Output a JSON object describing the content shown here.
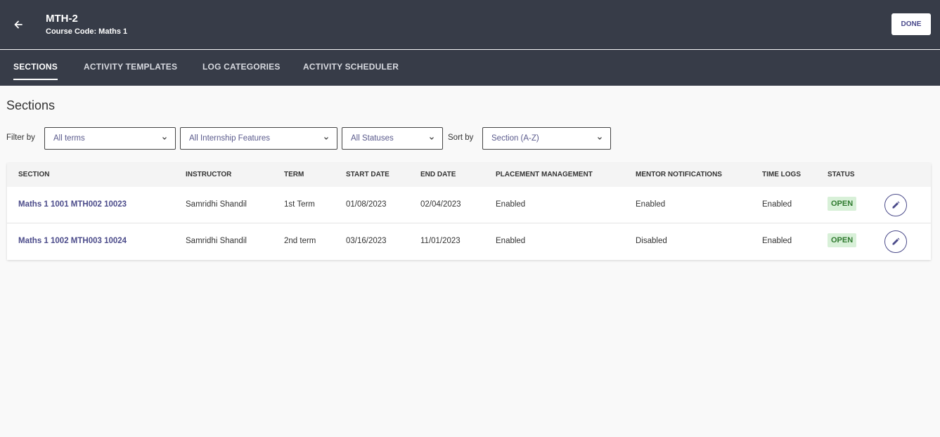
{
  "header": {
    "title": "MTH-2",
    "subtitle": "Course Code: Maths 1",
    "done_label": "DONE"
  },
  "tabs": [
    {
      "label": "SECTIONS",
      "active": true
    },
    {
      "label": "ACTIVITY TEMPLATES",
      "active": false
    },
    {
      "label": "LOG CATEGORIES",
      "active": false
    },
    {
      "label": "ACTIVITY SCHEDULER",
      "active": false
    }
  ],
  "page_title": "Sections",
  "filters": {
    "filter_label": "Filter by",
    "terms": "All terms",
    "features": "All Internship Features",
    "statuses": "All Statuses",
    "sort_label": "Sort by",
    "sort": "Section (A-Z)"
  },
  "table": {
    "columns": [
      "SECTION",
      "INSTRUCTOR",
      "TERM",
      "START DATE",
      "END DATE",
      "PLACEMENT MANAGEMENT",
      "MENTOR NOTIFICATIONS",
      "TIME LOGS",
      "STATUS"
    ],
    "rows": [
      {
        "section": "Maths 1 1001 MTH002 10023",
        "instructor": "Samridhi Shandil",
        "term": "1st Term",
        "start_date": "01/08/2023",
        "end_date": "02/04/2023",
        "placement": "Enabled",
        "mentor": "Enabled",
        "time_logs": "Enabled",
        "status": "OPEN"
      },
      {
        "section": "Maths 1 1002 MTH003 10024",
        "instructor": "Samridhi Shandil",
        "term": "2nd term",
        "start_date": "03/16/2023",
        "end_date": "11/01/2023",
        "placement": "Enabled",
        "mentor": "Disabled",
        "time_logs": "Enabled",
        "status": "OPEN"
      }
    ]
  },
  "icons": {
    "back": "arrow-left-icon",
    "dropdown": "chevron-down-icon",
    "edit": "pencil-icon"
  },
  "colors": {
    "header_bg": "#373c48",
    "accent": "#4b4b8a",
    "status_bg": "#d8f0d8",
    "status_text": "#2f7a2f"
  }
}
